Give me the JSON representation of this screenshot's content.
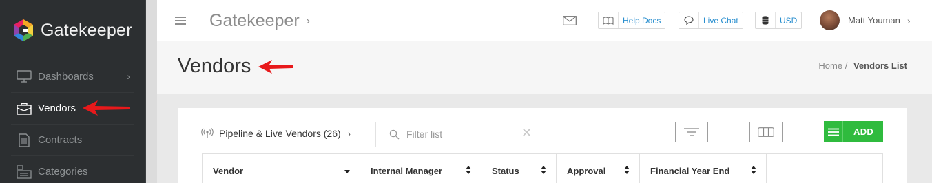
{
  "brand": {
    "name": "Gatekeeper"
  },
  "sidebar": {
    "items": [
      {
        "label": "Dashboards",
        "has_chevron": true,
        "active": false,
        "icon": "monitor-icon"
      },
      {
        "label": "Vendors",
        "has_chevron": false,
        "active": true,
        "icon": "briefcase-icon"
      },
      {
        "label": "Contracts",
        "has_chevron": false,
        "active": false,
        "icon": "document-icon"
      },
      {
        "label": "Categories",
        "has_chevron": false,
        "active": false,
        "icon": "categories-icon"
      }
    ]
  },
  "header": {
    "title": "Gatekeeper",
    "help_docs": "Help Docs",
    "live_chat": "Live Chat",
    "currency": "USD",
    "user_name": "Matt Youman"
  },
  "page": {
    "title": "Vendors",
    "breadcrumb_home": "Home",
    "breadcrumb_sep": "/",
    "breadcrumb_current": "Vendors List"
  },
  "toolbar": {
    "pipeline_label": "Pipeline & Live Vendors (26)",
    "filter_placeholder": "Filter list",
    "add_label": "ADD"
  },
  "table": {
    "columns": [
      "Vendor",
      "Internal Manager",
      "Status",
      "Approval",
      "Financial Year End",
      ""
    ]
  },
  "colors": {
    "sidebar_bg": "#2c2f31",
    "accent_blue": "#2a8fcf",
    "add_green": "#2fbb3e",
    "annotation_red": "#e8191b"
  }
}
